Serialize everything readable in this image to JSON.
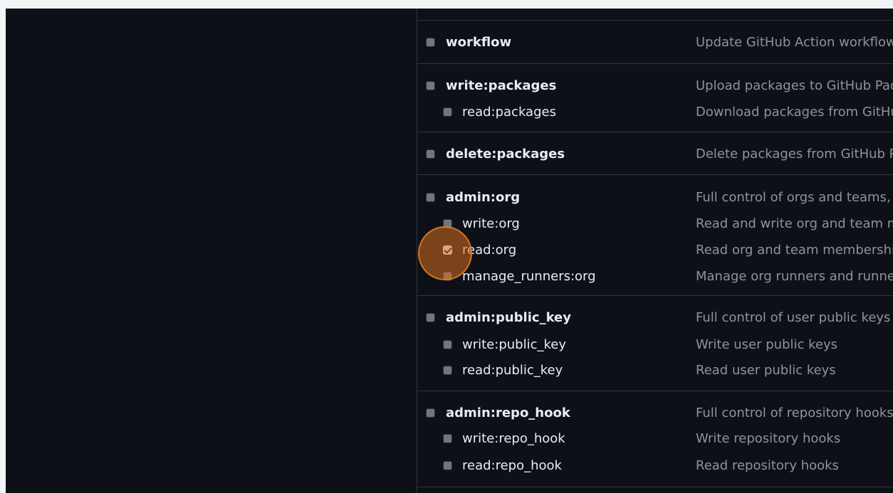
{
  "scopes": [
    {
      "parent": {
        "name": "workflow",
        "desc": "Update GitHub Action workflows",
        "checked": false
      },
      "children": []
    },
    {
      "parent": {
        "name": "write:packages",
        "desc": "Upload packages to GitHub Package Registry",
        "checked": false
      },
      "children": [
        {
          "name": "read:packages",
          "desc": "Download packages from GitHub Package Registry",
          "checked": false
        }
      ]
    },
    {
      "parent": {
        "name": "delete:packages",
        "desc": "Delete packages from GitHub Package Registry",
        "checked": false
      },
      "children": []
    },
    {
      "parent": {
        "name": "admin:org",
        "desc": "Full control of orgs and teams, read and write org projects",
        "checked": false
      },
      "children": [
        {
          "name": "write:org",
          "desc": "Read and write org and team membership, read and write org projects",
          "checked": false
        },
        {
          "name": "read:org",
          "desc": "Read org and team membership, read org projects",
          "checked": true
        },
        {
          "name": "manage_runners:org",
          "desc": "Manage org runners and runner groups",
          "checked": false
        }
      ]
    },
    {
      "parent": {
        "name": "admin:public_key",
        "desc": "Full control of user public keys",
        "checked": false
      },
      "children": [
        {
          "name": "write:public_key",
          "desc": "Write user public keys",
          "checked": false
        },
        {
          "name": "read:public_key",
          "desc": "Read user public keys",
          "checked": false
        }
      ]
    },
    {
      "parent": {
        "name": "admin:repo_hook",
        "desc": "Full control of repository hooks",
        "checked": false
      },
      "children": [
        {
          "name": "write:repo_hook",
          "desc": "Write repository hooks",
          "checked": false
        },
        {
          "name": "read:repo_hook",
          "desc": "Read repository hooks",
          "checked": false
        }
      ]
    }
  ],
  "colors": {
    "background": "#0d1117",
    "border": "#30363d",
    "text": "#e6edf3",
    "muted": "#8b949e",
    "click_highlight": "#d76e1e"
  }
}
